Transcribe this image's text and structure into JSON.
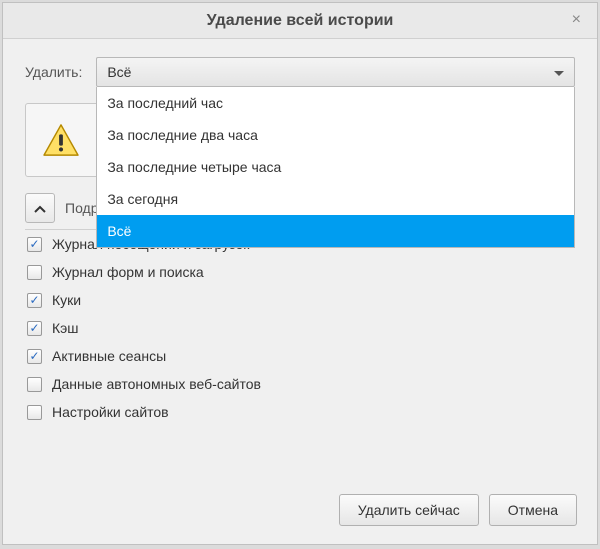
{
  "dialog": {
    "title": "Удаление всей истории",
    "close": "×"
  },
  "delete": {
    "label": "Удалить:",
    "selected": "Всё",
    "options": [
      "За последний час",
      "За последние два часа",
      "За последние четыре часа",
      "За сегодня",
      "Всё"
    ]
  },
  "details": {
    "label": "Подробности"
  },
  "checks": [
    {
      "label": "Журнал посещений и загрузок",
      "checked": true
    },
    {
      "label": "Журнал форм и поиска",
      "checked": false
    },
    {
      "label": "Куки",
      "checked": true
    },
    {
      "label": "Кэш",
      "checked": true
    },
    {
      "label": "Активные сеансы",
      "checked": true
    },
    {
      "label": "Данные автономных веб-сайтов",
      "checked": false
    },
    {
      "label": "Настройки сайтов",
      "checked": false
    }
  ],
  "buttons": {
    "delete_now": "Удалить сейчас",
    "cancel": "Отмена"
  }
}
